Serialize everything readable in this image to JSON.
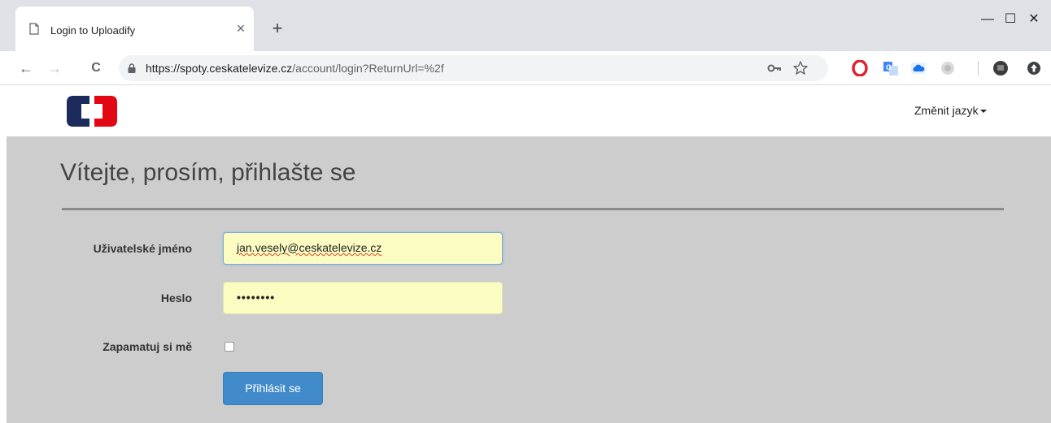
{
  "browser": {
    "tab_title": "Login to Uploadify",
    "tab_close": "×",
    "new_tab": "+",
    "window_controls": {
      "minimize": "—",
      "maximize": "☐",
      "close": "✕"
    },
    "nav": {
      "back": "←",
      "forward": "→",
      "reload": "C"
    },
    "url_host": "https://spoty.ceskatelevize.cz",
    "url_path": "/account/login?ReturnUrl=%2f",
    "omnibox_icons": [
      "key-icon",
      "star-icon"
    ],
    "extensions": [
      "opera-icon",
      "translate-icon",
      "cloud-icon",
      "grey-ext-icon",
      "profile-avatar",
      "update-icon"
    ]
  },
  "header": {
    "logo": "ceska-televize-logo",
    "language_menu": "Změnit jazyk"
  },
  "login": {
    "heading": "Vítejte, prosím, přihlašte se",
    "username_label": "Uživatelské jméno",
    "username_value": "jan.vesely@ceskatelevize.cz",
    "password_label": "Heslo",
    "password_value": "••••••••",
    "remember_label": "Zapamatuj si mě",
    "remember_checked": false,
    "submit_label": "Přihlásit se"
  },
  "colors": {
    "logo_blue": "#1a2b5c",
    "logo_red": "#e30613",
    "content_bg": "#cdcdcd",
    "input_bg": "#fafcc2",
    "button_bg": "#428bca"
  }
}
